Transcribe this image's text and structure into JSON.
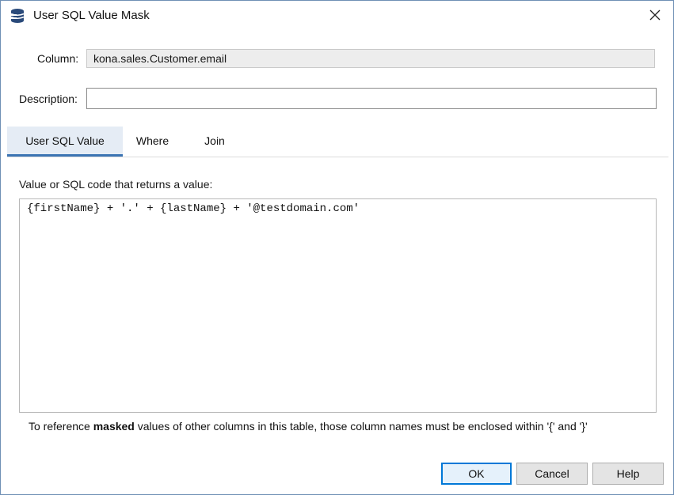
{
  "window": {
    "title": "User SQL Value Mask",
    "app_icon": "database-stack-icon",
    "close_icon": "close-icon"
  },
  "form": {
    "column_label": "Column:",
    "column_value": "kona.sales.Customer.email",
    "description_label": "Description:",
    "description_value": ""
  },
  "tabs": [
    {
      "label": "User SQL Value",
      "active": true
    },
    {
      "label": "Where",
      "active": false
    },
    {
      "label": "Join",
      "active": false
    }
  ],
  "sql_panel": {
    "label": "Value or SQL code that returns a value:",
    "code": "{firstName} + '.' + {lastName} + '@testdomain.com'"
  },
  "hint": {
    "prefix": "To reference ",
    "emphasis": "masked",
    "suffix": " values of other columns in this table, those column names must be enclosed within '{' and '}'"
  },
  "buttons": {
    "ok": "OK",
    "cancel": "Cancel",
    "help": "Help"
  },
  "colors": {
    "accent": "#0078d7",
    "tab_underline": "#3c74b3",
    "tab_active_bg": "#e5ecf5"
  }
}
